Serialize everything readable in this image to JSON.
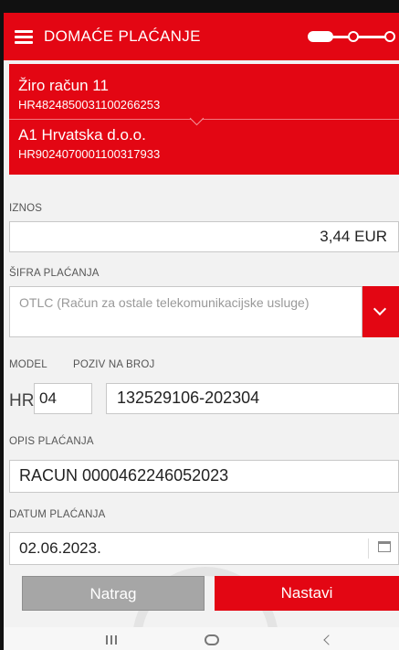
{
  "header": {
    "title": "DOMAĆE PLAĆANJE",
    "menu_icon": "hamburger-menu-icon",
    "progress": {
      "total_steps": 3,
      "current_step": 1
    }
  },
  "accounts": {
    "payer": {
      "name": "Žiro račun 11",
      "iban": "HR4824850031100266253"
    },
    "payee": {
      "name": "A1 Hrvatska d.o.o.",
      "iban": "HR9024070001100317933"
    }
  },
  "form": {
    "amount": {
      "label": "IZNOS",
      "value": "3,44 EUR"
    },
    "payment_code": {
      "label": "ŠIFRA PLAĆANJA",
      "value": "OTLC (Račun za ostale telekomunikacijske usluge)"
    },
    "model": {
      "label": "MODEL",
      "prefix": "HR",
      "value": "04"
    },
    "reference": {
      "label": "POZIV NA BROJ",
      "value": "132529106-202304"
    },
    "description": {
      "label": "OPIS PLAĆANJA",
      "value": "RACUN 0000462246052023"
    },
    "date": {
      "label": "DATUM PLAĆANJA",
      "value": "02.06.2023."
    }
  },
  "buttons": {
    "back": "Natrag",
    "next": "Nastavi"
  },
  "system_nav": {
    "recent_icon": "recent-apps-icon",
    "home_icon": "home-icon",
    "back_icon": "back-icon"
  },
  "colors": {
    "accent": "#e30613",
    "back_button": "#a6a6a6"
  }
}
